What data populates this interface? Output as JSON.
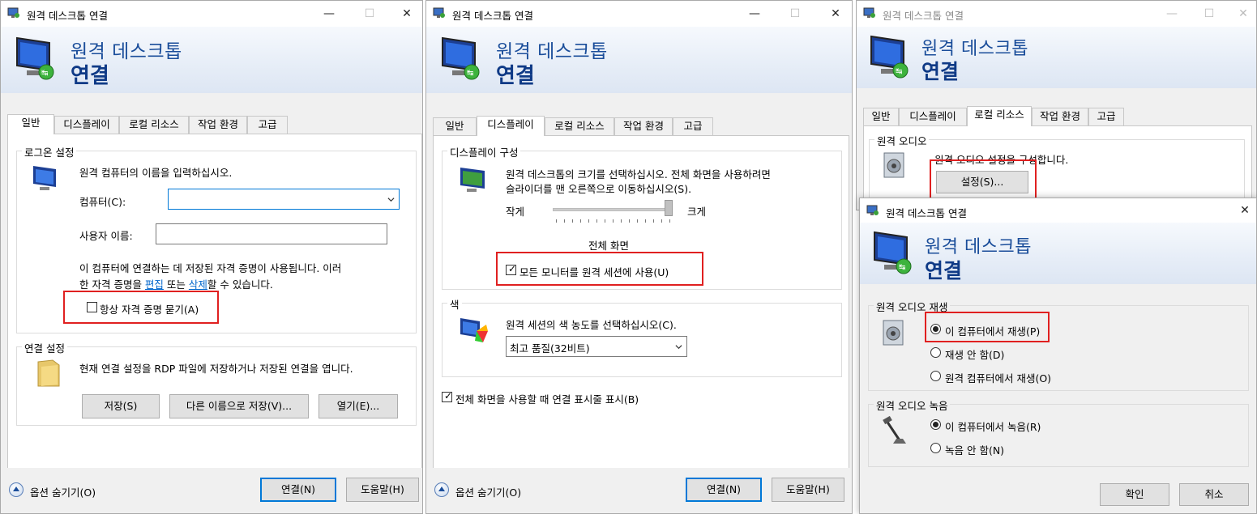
{
  "window1": {
    "title": "원격 데스크톱 연결",
    "banner_line1": "원격 데스크톱",
    "banner_line2": "연결",
    "tabs": [
      "일반",
      "디스플레이",
      "로컬 리소스",
      "작업 환경",
      "고급"
    ],
    "active_tab": "일반",
    "logon_group": "로그온 설정",
    "logon_desc": "원격 컴퓨터의 이름을 입력하십시오.",
    "computer_label": "컴퓨터(C):",
    "computer_value": "",
    "user_label": "사용자 이름:",
    "user_value": "",
    "cred_line1": "이 컴퓨터에 연결하는 데 저장된 자격 증명이 사용됩니다. 이러",
    "cred_line2_a": "한 자격 증명을 ",
    "cred_edit_link": "편집",
    "cred_line2_b": " 또는 ",
    "cred_delete_link": "삭제",
    "cred_line2_c": "할 수 있습니다.",
    "always_ask_label": "항상 자격 증명 묻기(A)",
    "always_ask_checked": false,
    "conn_group": "연결 설정",
    "conn_desc": "현재 연결 설정을 RDP 파일에 저장하거나 저장된 연결을 엽니다.",
    "save_button": "저장(S)",
    "save_as_button": "다른 이름으로 저장(V)...",
    "open_button": "열기(E)...",
    "hide_options": "옵션 숨기기(O)",
    "connect_button": "연결(N)",
    "help_button": "도움말(H)"
  },
  "window2": {
    "title": "원격 데스크톱 연결",
    "banner_line1": "원격 데스크톱",
    "banner_line2": "연결",
    "tabs": [
      "일반",
      "디스플레이",
      "로컬 리소스",
      "작업 환경",
      "고급"
    ],
    "active_tab": "디스플레이",
    "display_group": "디스플레이 구성",
    "display_desc_line1": "원격 데스크톱의 크기를 선택하십시오. 전체 화면을 사용하려면",
    "display_desc_line2": "슬라이더를 맨 오른쪽으로 이동하십시오(S).",
    "slider_small": "작게",
    "slider_large": "크게",
    "slider_value_label": "전체 화면",
    "slider_level": 1.0,
    "all_monitors_label": "모든 모니터를 원격 세션에 사용(U)",
    "all_monitors_checked": true,
    "color_group": "색",
    "color_desc": "원격 세션의 색 농도를 선택하십시오(C).",
    "color_value": "최고 품질(32비트)",
    "connbar_label": "전체 화면을 사용할 때 연결 표시줄 표시(B)",
    "connbar_checked": true,
    "hide_options": "옵션 숨기기(O)",
    "connect_button": "연결(N)",
    "help_button": "도움말(H)"
  },
  "window3": {
    "title": "원격 데스크톱 연결",
    "banner_line1": "원격 데스크톱",
    "banner_line2": "연결",
    "tabs": [
      "일반",
      "디스플레이",
      "로컬 리소스",
      "작업 환경",
      "고급"
    ],
    "active_tab": "로컬 리소스",
    "audio_group": "원격 오디오",
    "audio_desc": "원격 오디오 설정을 구성합니다.",
    "settings_button": "설정(S)..."
  },
  "dialog": {
    "title": "원격 데스크톱 연결",
    "banner_line1": "원격 데스크톱",
    "banner_line2": "연결",
    "playback_group": "원격 오디오 재생",
    "playback_options": [
      "이 컴퓨터에서 재생(P)",
      "재생 안 함(D)",
      "원격 컴퓨터에서 재생(O)"
    ],
    "playback_selected": 0,
    "record_group": "원격 오디오 녹음",
    "record_options": [
      "이 컴퓨터에서 녹음(R)",
      "녹음 안 함(N)"
    ],
    "record_selected": 0,
    "ok_button": "확인",
    "cancel_button": "취소"
  },
  "colors": {
    "accent": "#0078d7",
    "highlight": "#e02020",
    "banner_text": "#1a4d9a"
  }
}
